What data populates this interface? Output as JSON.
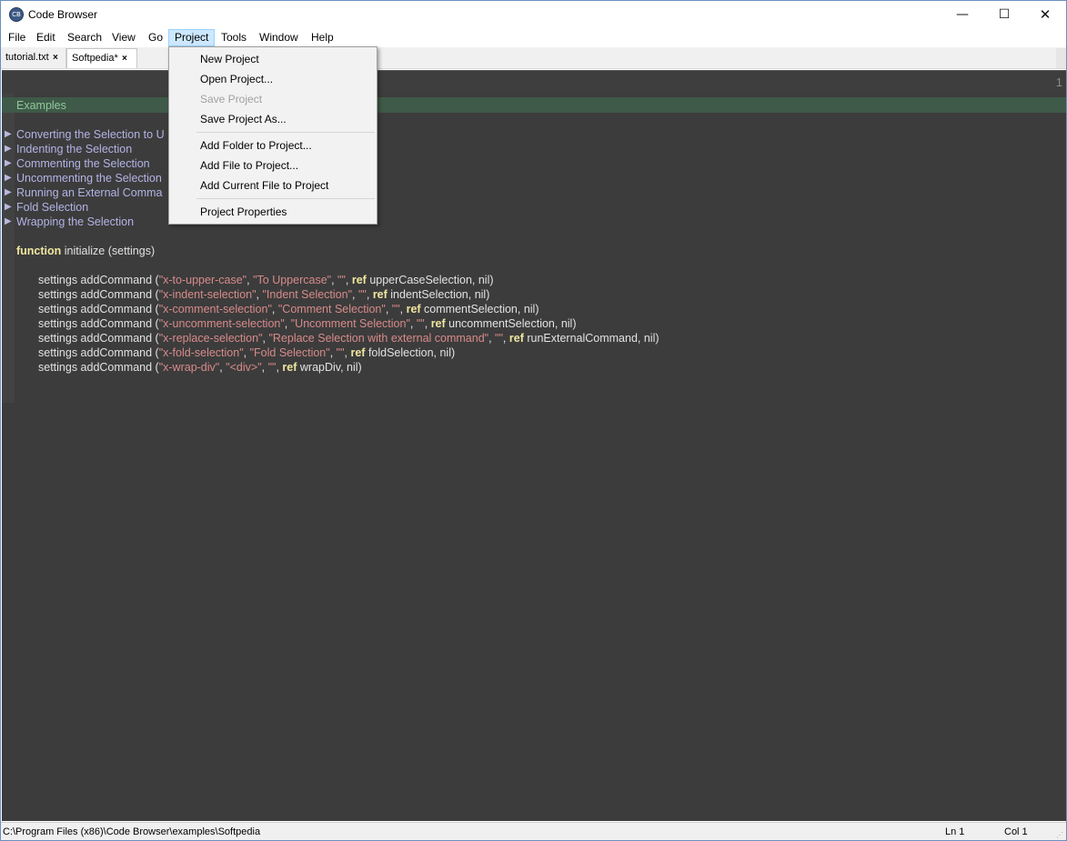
{
  "window": {
    "title": "Code Browser",
    "app_icon": "CB",
    "minimize": "—",
    "maximize": "☐",
    "close": "✕"
  },
  "menubar": {
    "items": [
      "File",
      "Edit",
      "Search",
      "View",
      "Go",
      "Project",
      "Tools",
      "Window",
      "Help"
    ],
    "active": "Project"
  },
  "tabs": [
    {
      "label": "tutorial.txt",
      "close": "×"
    },
    {
      "label": "Softpedia*",
      "close": "×",
      "active": true
    }
  ],
  "editor": {
    "line_number": "1",
    "section_title": "Examples",
    "fold_arrow": "▶",
    "folds": [
      "Converting the Selection to U",
      "Indenting the Selection",
      "Commenting the Selection",
      "Uncommenting the Selection",
      "Running an External Comma",
      "Fold Selection",
      "Wrapping the Selection"
    ],
    "function_keyword": "function",
    "function_rest": " initialize (settings)",
    "commands": [
      {
        "pre": "settings addCommand (",
        "id": "\"x-to-upper-case\"",
        "sep1": ", ",
        "label": "\"To Uppercase\"",
        "sep2": ", ",
        "empty": "\"\"",
        "sep3": ", ",
        "ref": "ref",
        "post": " upperCaseSelection, nil)"
      },
      {
        "pre": "settings addCommand (",
        "id": "\"x-indent-selection\"",
        "sep1": ", ",
        "label": "\"Indent Selection\"",
        "sep2": ", ",
        "empty": "\"\"",
        "sep3": ", ",
        "ref": "ref",
        "post": " indentSelection, nil)"
      },
      {
        "pre": "settings addCommand (",
        "id": "\"x-comment-selection\"",
        "sep1": ", ",
        "label": "\"Comment Selection\"",
        "sep2": ", ",
        "empty": "\"\"",
        "sep3": ", ",
        "ref": "ref",
        "post": " commentSelection, nil)"
      },
      {
        "pre": "settings addCommand (",
        "id": "\"x-uncomment-selection\"",
        "sep1": ", ",
        "label": "\"Uncomment Selection\"",
        "sep2": ", ",
        "empty": "\"\"",
        "sep3": ", ",
        "ref": "ref",
        "post": " uncommentSelection, nil)"
      },
      {
        "pre": "settings addCommand (",
        "id": "\"x-replace-selection\"",
        "sep1": ", ",
        "label": "\"Replace Selection with external command\"",
        "sep2": ", ",
        "empty": "\"\"",
        "sep3": ", ",
        "ref": "ref",
        "post": " runExternalCommand, nil)"
      },
      {
        "pre": "settings addCommand (",
        "id": "\"x-fold-selection\"",
        "sep1": ", ",
        "label": "\"Fold Selection\"",
        "sep2": ", ",
        "empty": "\"\"",
        "sep3": ", ",
        "ref": "ref",
        "post": " foldSelection, nil)"
      },
      {
        "pre": "settings addCommand (",
        "id": "\"x-wrap-div\"",
        "sep1": ", ",
        "label": "\"<div>\"",
        "sep2": ", ",
        "empty": "\"\"",
        "sep3": ", ",
        "ref": "ref",
        "post": " wrapDiv, nil)"
      }
    ]
  },
  "project_menu": {
    "items": [
      {
        "label": "New Project",
        "enabled": true
      },
      {
        "label": "Open Project...",
        "enabled": true
      },
      {
        "label": "Save Project",
        "enabled": false
      },
      {
        "label": "Save Project As...",
        "enabled": true
      },
      {
        "label": "Add Folder to Project...",
        "enabled": true
      },
      {
        "label": "Add File to Project...",
        "enabled": true
      },
      {
        "label": "Add Current File to Project",
        "enabled": true
      },
      {
        "label": "Project Properties",
        "enabled": true
      }
    ]
  },
  "watermark": "SOFTPEDIA",
  "statusbar": {
    "path": "C:\\Program Files (x86)\\Code Browser\\examples\\Softpedia",
    "line": "Ln 1",
    "column": "Col 1"
  },
  "colors": {
    "editor_bg": "#3c3c3c",
    "section_title": "#8fc89a",
    "fold_text": "#b3b3e6",
    "keyword": "#f0e6a0",
    "string": "#d88a8a",
    "menu_highlight": "#cce8ff"
  }
}
